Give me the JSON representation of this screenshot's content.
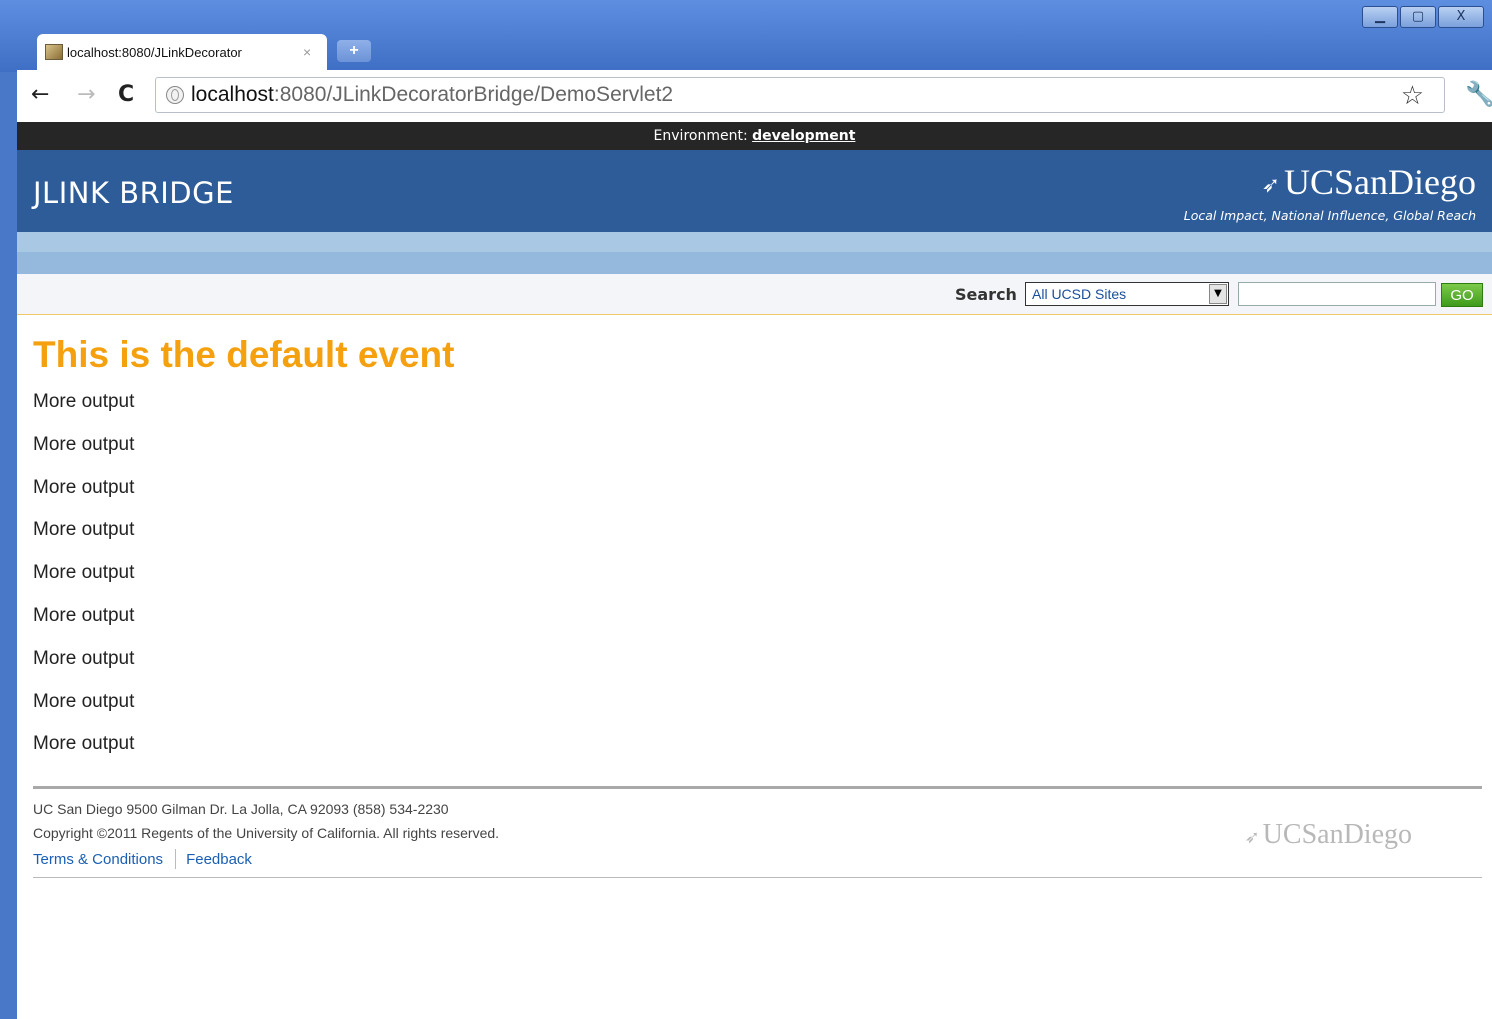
{
  "browser": {
    "tab_title": "localhost:8080/JLinkDecorator",
    "tab_close": "×",
    "new_tab": "+",
    "url_host": "localhost",
    "url_rest": ":8080/JLinkDecoratorBridge/DemoServlet2",
    "window_buttons": {
      "minimize": "▁",
      "maximize": "▢",
      "close": "X"
    },
    "icons": {
      "back": "←",
      "forward": "→",
      "reload": "C",
      "star": "☆",
      "wrench": "🔧"
    }
  },
  "environment": {
    "label": "Environment: ",
    "value": "development"
  },
  "header": {
    "site_title": "JLINK BRIDGE",
    "logo_text": "UCSanDiego",
    "logo_tagline": "Local Impact, National Influence, Global Reach"
  },
  "search": {
    "label": "Search",
    "scope_selected": "All UCSD Sites",
    "query": "",
    "go_label": "GO"
  },
  "main": {
    "heading": "This is the default event",
    "lines": [
      "More output",
      "More output",
      "More output",
      "More output",
      "More output",
      "More output",
      "More output",
      "More output",
      "More output"
    ]
  },
  "footer": {
    "address": "UC San Diego 9500 Gilman Dr. La Jolla, CA 92093 (858) 534-2230",
    "copyright": "Copyright ©2011 Regents of the University of California. All rights reserved.",
    "links": [
      "Terms & Conditions",
      "Feedback"
    ],
    "logo_text": "UCSanDiego"
  },
  "colors": {
    "masthead": "#2d5c99",
    "heading": "#f5a10f",
    "go_button": "#4caa25",
    "env_bar": "#262626"
  }
}
